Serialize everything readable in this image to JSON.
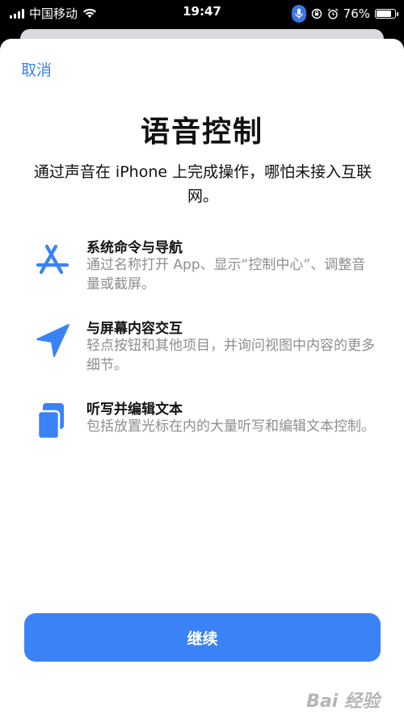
{
  "status_bar": {
    "carrier": "中国移动",
    "time": "19:47",
    "battery": "76%",
    "battery_level": 0.76
  },
  "sheet": {
    "cancel_label": "取消",
    "title": "语音控制",
    "subtitle": "通过声音在 iPhone 上完成操作，哪怕未接入互联网。",
    "features": [
      {
        "icon": "app-store-icon",
        "title": "系统命令与导航",
        "description": "通过名称打开 App、显示“控制中心”、调整音量或截屏。"
      },
      {
        "icon": "location-arrow-icon",
        "title": "与屏幕内容交互",
        "description": "轻点按钮和其他项目，并询问视图中内容的更多细节。"
      },
      {
        "icon": "documents-icon",
        "title": "听写并编辑文本",
        "description": "包括放置光标在内的大量听写和编辑文本控制。"
      }
    ],
    "continue_label": "继续"
  },
  "watermark": "Bai 经验",
  "colors": {
    "accent": "#3b82f6",
    "secondary_text": "#8e8e93"
  }
}
